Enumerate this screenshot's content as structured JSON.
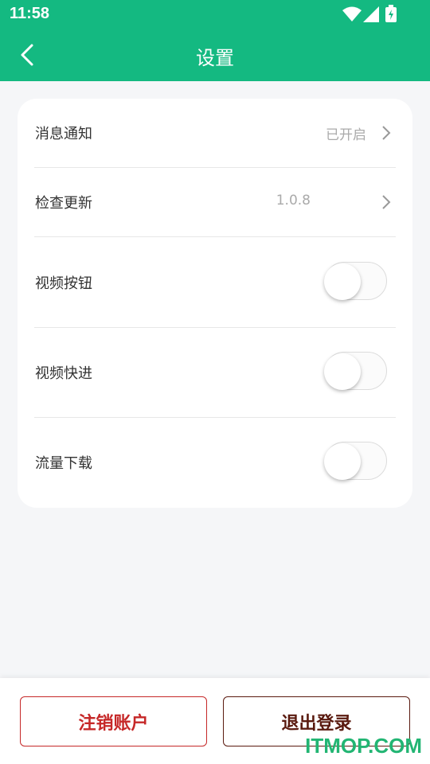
{
  "status_bar": {
    "time": "11:58"
  },
  "header": {
    "title": "设置"
  },
  "settings": {
    "notifications": {
      "label": "消息通知",
      "value": "已开启"
    },
    "check_update": {
      "label": "检查更新",
      "value": "1.0.8"
    },
    "video_buttons": {
      "label": "视频按钮",
      "enabled": false
    },
    "video_fast_forward": {
      "label": "视频快进",
      "enabled": false
    },
    "cellular_download": {
      "label": "流量下载",
      "enabled": false
    }
  },
  "buttons": {
    "cancel_account": "注销账户",
    "logout": "退出登录"
  },
  "watermark": "ITMOP.COM",
  "colors": {
    "brand": "#14b981",
    "danger": "#c62828",
    "logout": "#5a1a0f"
  }
}
